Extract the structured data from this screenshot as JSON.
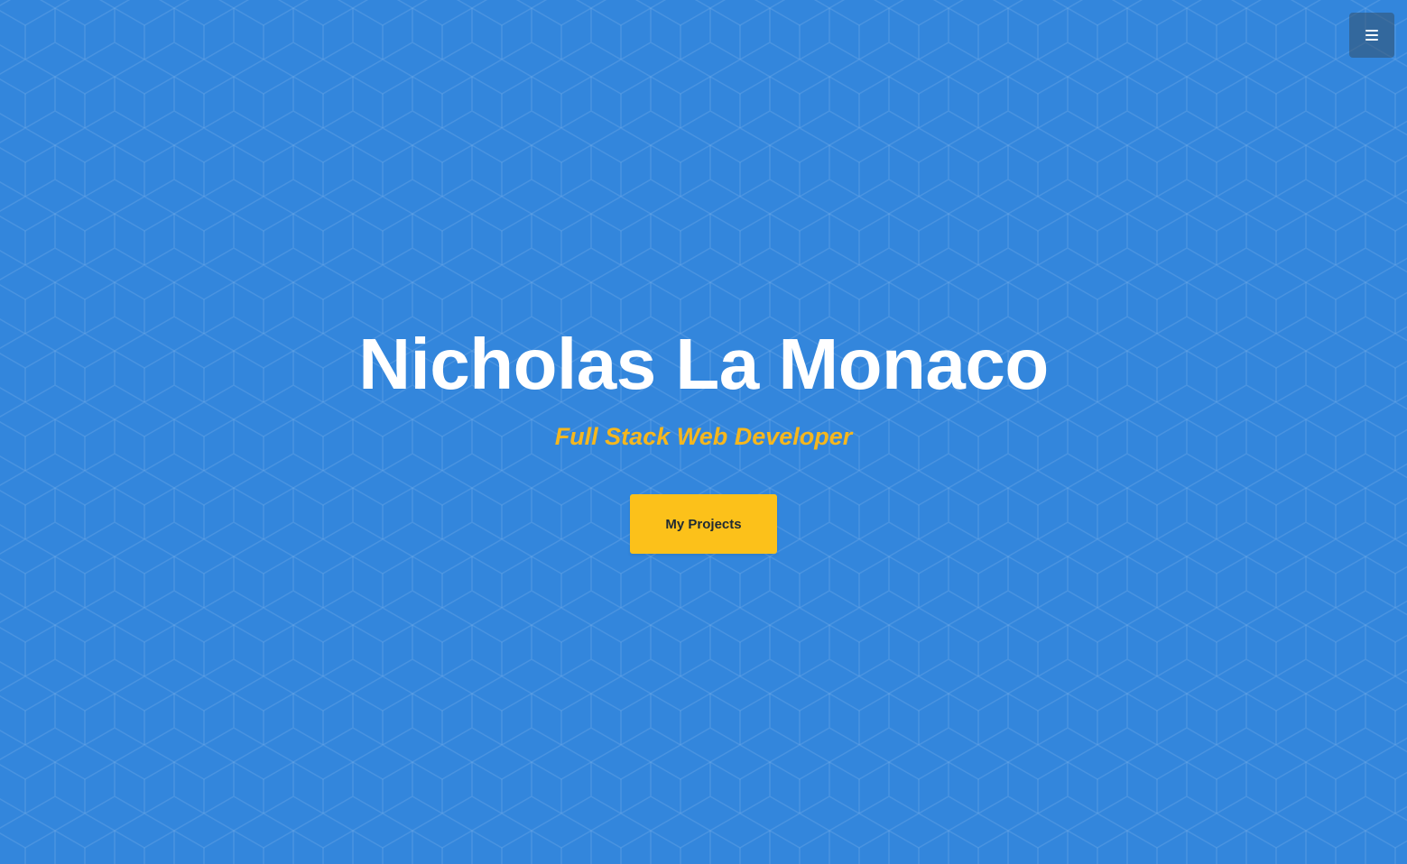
{
  "hero": {
    "name": "Nicholas La Monaco",
    "tagline": "Full Stack Web Developer",
    "cta_label": "My Projects"
  },
  "nav": {
    "menu_icon": "hamburger-menu-icon"
  },
  "colors": {
    "background": "#3386dc",
    "accent": "#fcc11a",
    "tagline": "#f5b71e",
    "title": "#ffffff",
    "menu_button": "#34495e"
  }
}
